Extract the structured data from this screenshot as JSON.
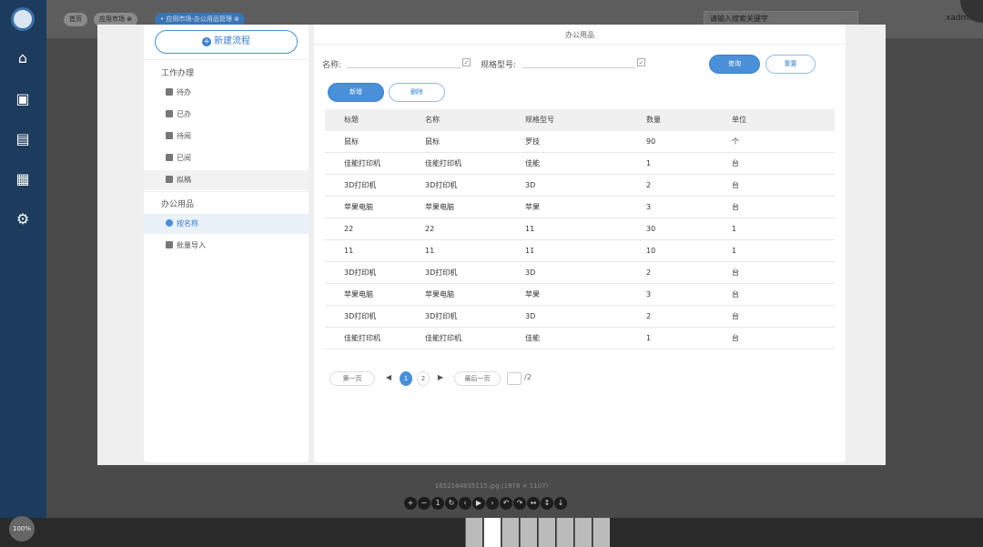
{
  "topbar": {
    "tabs": [
      {
        "label": "首页"
      },
      {
        "label": "应用市场"
      },
      {
        "label": "应用市场-办公用品管理"
      }
    ],
    "search_placeholder": "请输入搜索关键字",
    "username": "xadmin"
  },
  "viewer": {
    "file_info": "1652164835115.jpg (1978 × 1107)",
    "zoom": "100%"
  },
  "sidebar": {
    "new_flow_label": "新建流程",
    "group_work": "工作办理",
    "work_items": [
      {
        "label": "待办",
        "icon": "list-icon"
      },
      {
        "label": "已办",
        "icon": "done-icon"
      },
      {
        "label": "待阅",
        "icon": "doc-icon"
      },
      {
        "label": "已阅",
        "icon": "eye-icon"
      },
      {
        "label": "拟稿",
        "icon": "draft-icon"
      }
    ],
    "group_supplies": "办公用品",
    "supplies_items": [
      {
        "label": "按名称",
        "icon": "search-circle-icon"
      },
      {
        "label": "批量导入",
        "icon": "import-icon"
      }
    ]
  },
  "panel": {
    "title": "办公用品",
    "filter_name_label": "名称:",
    "filter_model_label": "规格型号:",
    "query_label": "查询",
    "reset_label": "重置",
    "add_label": "新增",
    "delete_label": "删除"
  },
  "table": {
    "headers": [
      "标题",
      "名称",
      "规格型号",
      "数量",
      "单位"
    ],
    "rows": [
      [
        "鼠标",
        "鼠标",
        "罗技",
        "90",
        "个"
      ],
      [
        "佳能打印机",
        "佳能打印机",
        "佳能",
        "1",
        "台"
      ],
      [
        "3D打印机",
        "3D打印机",
        "3D",
        "2",
        "台"
      ],
      [
        "苹果电脑",
        "苹果电脑",
        "苹果",
        "3",
        "台"
      ],
      [
        "22",
        "22",
        "11",
        "30",
        "1"
      ],
      [
        "11",
        "11",
        "11",
        "10",
        "1"
      ],
      [
        "3D打印机",
        "3D打印机",
        "3D",
        "2",
        "台"
      ],
      [
        "苹果电脑",
        "苹果电脑",
        "苹果",
        "3",
        "台"
      ],
      [
        "3D打印机",
        "3D打印机",
        "3D",
        "2",
        "台"
      ],
      [
        "佳能打印机",
        "佳能打印机",
        "佳能",
        "1",
        "台"
      ]
    ]
  },
  "pager": {
    "first_label": "第一页",
    "last_label": "最后一页",
    "pages": [
      "1",
      "2"
    ],
    "current": "1",
    "total": "/2"
  },
  "colors": {
    "accent": "#4a90d9",
    "sidebar_bg": "#1d3b5c"
  }
}
